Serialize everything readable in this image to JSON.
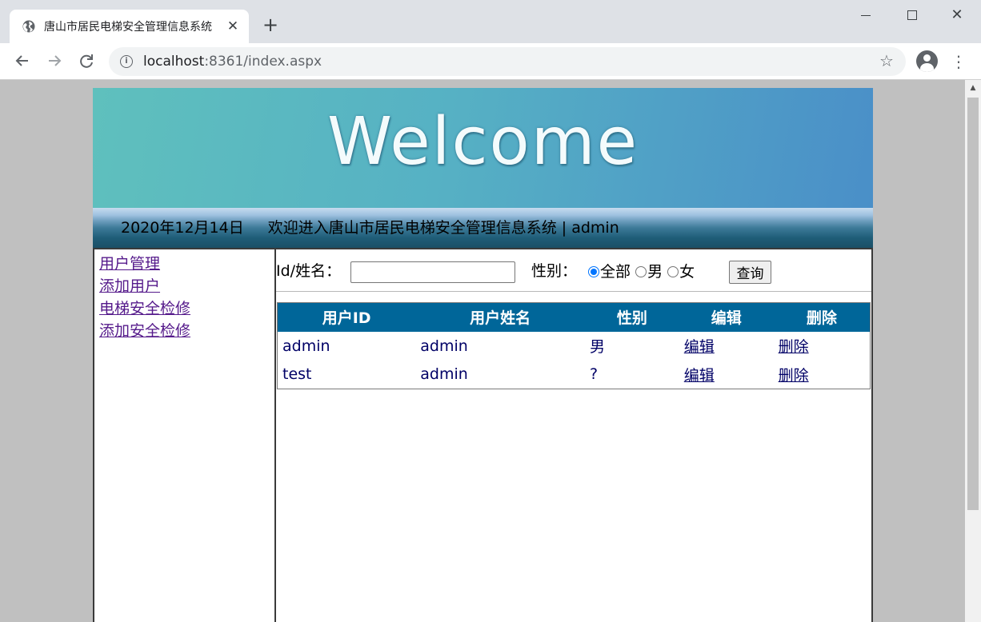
{
  "browser": {
    "tab_title": "唐山市居民电梯安全管理信息系统",
    "close_glyph": "✕",
    "new_tab_glyph": "+",
    "url_host": "localhost",
    "url_path": ":8361/index.aspx",
    "window_controls": {
      "close_glyph": "✕"
    }
  },
  "banner": {
    "text": "Welcome"
  },
  "status": {
    "date": "2020年12月14日",
    "welcome": "欢迎进入唐山市居民电梯安全管理信息系统 | admin"
  },
  "nav": {
    "items": [
      {
        "label": "用户管理"
      },
      {
        "label": "添加用户"
      },
      {
        "label": "电梯安全检修"
      },
      {
        "label": "添加安全检修"
      }
    ]
  },
  "search": {
    "id_label": "Id/姓名：",
    "id_value": "",
    "gender_label": "性别：",
    "options": [
      {
        "label": "全部",
        "checked": true
      },
      {
        "label": "男",
        "checked": false
      },
      {
        "label": "女",
        "checked": false
      }
    ],
    "query_label": "查询"
  },
  "table": {
    "headers": [
      "用户ID",
      "用户姓名",
      "性别",
      "编辑",
      "删除"
    ],
    "rows": [
      {
        "id": "admin",
        "name": "admin",
        "gender": "男",
        "edit": "编辑",
        "delete": "删除"
      },
      {
        "id": "test",
        "name": "admin",
        "gender": "?",
        "edit": "编辑",
        "delete": "删除"
      }
    ]
  },
  "colors": {
    "table_header": "#006699",
    "table_text": "#000066",
    "visited_link": "#551a8b",
    "radio_accent": "#0075ff"
  },
  "icons": [
    "globe-icon",
    "close-icon",
    "plus-icon",
    "back-icon",
    "forward-icon",
    "reload-icon",
    "info-icon",
    "star-icon",
    "profile-icon",
    "menu-icon"
  ]
}
